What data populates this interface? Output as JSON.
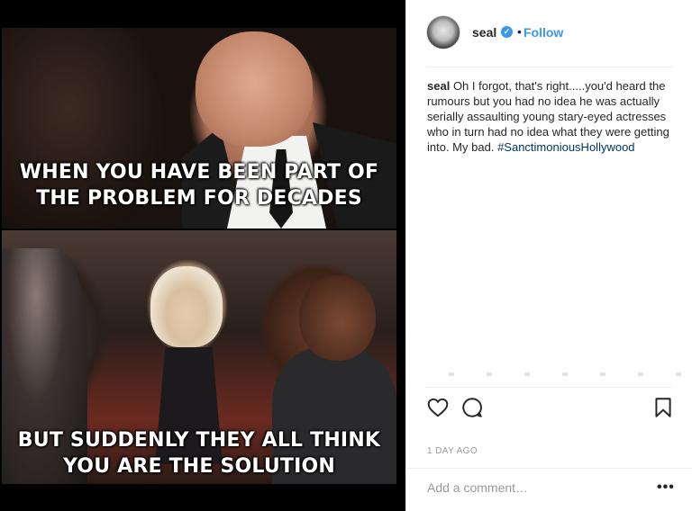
{
  "post": {
    "caption_top": "WHEN YOU HAVE BEEN PART OF\nTHE PROBLEM FOR DECADES",
    "caption_bottom": "BUT SUDDENLY THEY ALL THINK\nYOU ARE THE SOLUTION"
  },
  "header": {
    "username": "seal",
    "separator": "•",
    "follow_label": "Follow",
    "verified_icon": "verified-badge-icon"
  },
  "comment": {
    "author": "seal",
    "text": "Oh I forgot, that's right.....you'd heard the rumours but you had no idea he was actually serially assaulting young stary-eyed actresses who in turn had no idea what they were getting into. My bad.",
    "hashtag": "#SanctimoniousHollywood"
  },
  "actions": {
    "icons": [
      "heart-icon",
      "comment-icon",
      "bookmark-icon"
    ]
  },
  "meta": {
    "timestamp": "1 DAY AGO",
    "add_comment_placeholder": "Add a comment…",
    "more_label": "•••"
  },
  "colors": {
    "accent": "#3897f0",
    "hashtag": "#003569",
    "muted": "#999999",
    "text": "#262626"
  }
}
